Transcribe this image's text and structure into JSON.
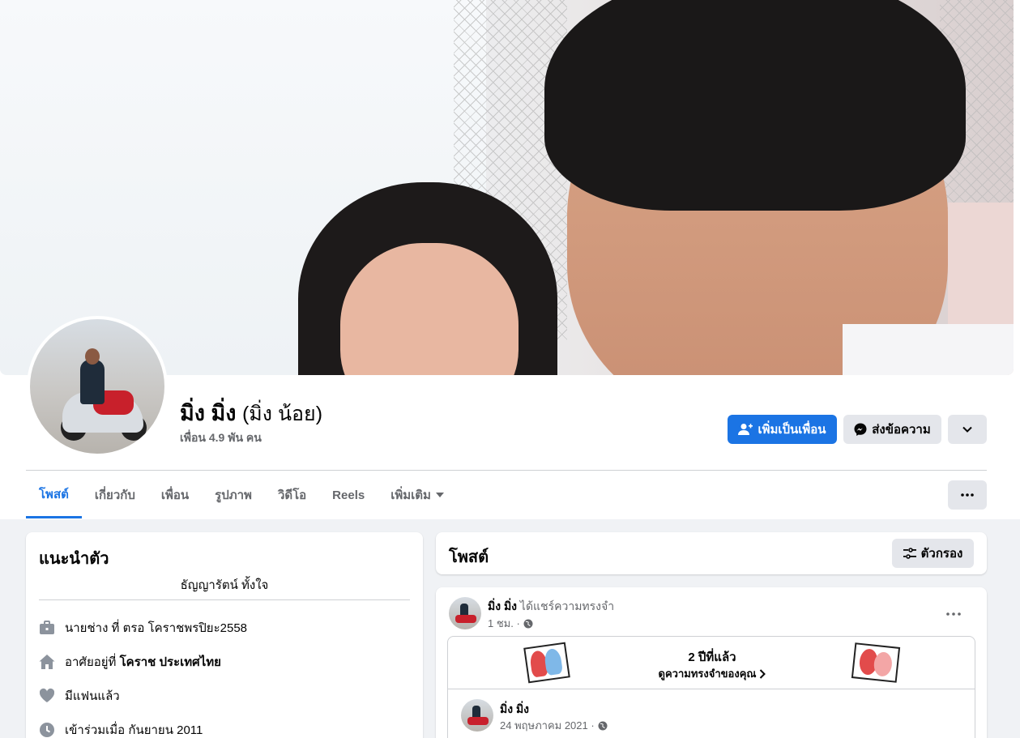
{
  "profile": {
    "name": "มิ่ง มิ่ง",
    "alternate_name": "(มิ่ง น้อย)",
    "friends_count": "เพื่อน 4.9 พัน คน"
  },
  "actions": {
    "add_friend": "เพิ่มเป็นเพื่อน",
    "message": "ส่งข้อความ"
  },
  "tabs": [
    {
      "label": "โพสต์"
    },
    {
      "label": "เกี่ยวกับ"
    },
    {
      "label": "เพื่อน"
    },
    {
      "label": "รูปภาพ"
    },
    {
      "label": "วิดีโอ"
    },
    {
      "label": "Reels"
    },
    {
      "label": "เพิ่มเติม"
    }
  ],
  "intro": {
    "title": "แนะนำตัว",
    "bio": "ธัญญารัตน์ ทั้งใจ",
    "work": "นายช่าง ที่ ตรอ โคราชพรปิยะ2558",
    "lives_prefix": "อาศัยอยู่ที่ ",
    "lives_place": "โคราช ประเทศไทย",
    "relationship": "มีแฟนแล้ว",
    "joined": "เข้าร่วมเมื่อ กันยายน 2011"
  },
  "posts_header": {
    "title": "โพสต์",
    "filter_label": "ตัวกรอง"
  },
  "post": {
    "author": "มิ่ง มิ่ง",
    "action": "ได้แชร์ความทรงจำ",
    "time": "1 ชม. ·",
    "memory_title": "2 ปีที่แล้ว",
    "memory_link": "ดูความทรงจำของคุณ",
    "inner_author": "มิ่ง มิ่ง",
    "inner_date": "24 พฤษภาคม 2021 ·"
  },
  "colors": {
    "accent": "#1b74e4",
    "background": "#f0f2f5"
  }
}
